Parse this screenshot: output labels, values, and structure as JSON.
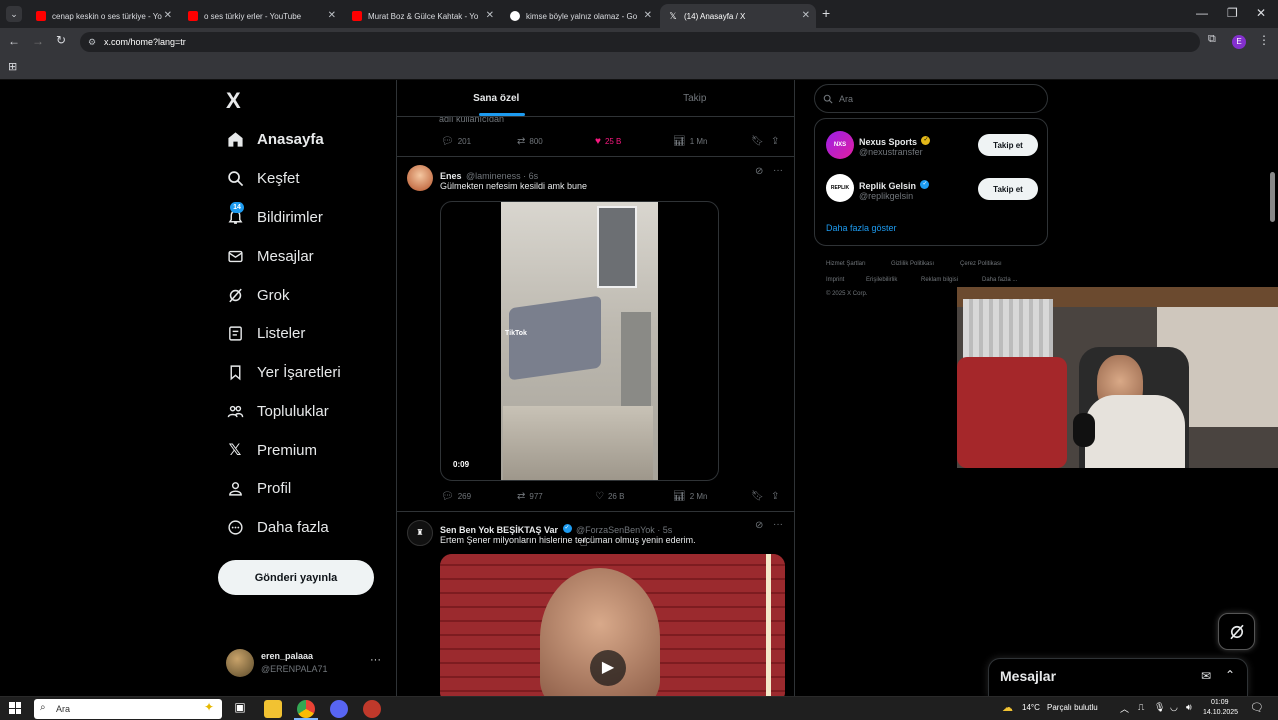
{
  "browser": {
    "tabs": [
      {
        "title": "cenap keskin o ses türkiye - Yo",
        "favicon_color": "#ff0000"
      },
      {
        "title": "o ses türkiy erler - YouTube",
        "favicon_color": "#ff0000"
      },
      {
        "title": "Murat Boz & Gülce Kahtak - Yo",
        "favicon_color": "#ff0000"
      },
      {
        "title": "kimse böyle yalnız olamaz - Go",
        "favicon_color": "#ffffff"
      },
      {
        "title": "(14) Anasayfa / X",
        "favicon_color": "#000000"
      }
    ],
    "new_tab": "+",
    "url": "x.com/home?lang=tr",
    "profile_initial": "E"
  },
  "nav": {
    "logo": "X",
    "items": [
      {
        "label": "Anasayfa",
        "icon": "home-icon"
      },
      {
        "label": "Keşfet",
        "icon": "search-icon"
      },
      {
        "label": "Bildirimler",
        "icon": "bell-icon",
        "badge": "14"
      },
      {
        "label": "Mesajlar",
        "icon": "mail-icon"
      },
      {
        "label": "Grok",
        "icon": "grok-icon"
      },
      {
        "label": "Listeler",
        "icon": "list-icon"
      },
      {
        "label": "Yer İşaretleri",
        "icon": "bookmark-icon"
      },
      {
        "label": "Topluluklar",
        "icon": "communities-icon"
      },
      {
        "label": "Premium",
        "icon": "x-premium-icon"
      },
      {
        "label": "Profil",
        "icon": "profile-icon"
      },
      {
        "label": "Daha fazla",
        "icon": "more-circle-icon"
      }
    ],
    "post_button": "Gönderi yayınla",
    "account": {
      "name": "eren_palaaa",
      "handle": "@ERENPALA71"
    }
  },
  "timeline": {
    "tabs": [
      {
        "label": "Sana özel"
      },
      {
        "label": "Takip"
      }
    ],
    "partial_tweet": {
      "text": "adlı kullanıcıdan",
      "replies": "201",
      "reposts": "800",
      "likes": "25 B",
      "views": "1 Mn"
    },
    "tweets": [
      {
        "name": "Enes",
        "handle": "@lamineness · 6s",
        "text": "Gülmekten nefesim kesildi amk bune",
        "video_time": "0:09",
        "watermark": "TikTok",
        "replies": "269",
        "reposts": "977",
        "likes": "26 B",
        "views": "2 Mn"
      },
      {
        "name": "Sen Ben Yok BEŞİKTAŞ Var",
        "handle": "@ForzaSenBenYok · 5s",
        "text": "Ertem Şener milyonların hislerine tercüman olmuş yenin ederim."
      }
    ]
  },
  "sidebar": {
    "search_placeholder": "Ara",
    "suggestions": [
      {
        "name": "Nexus Sports",
        "handle": "@nexustransfer",
        "verified_color": "#e2b719",
        "button": "Takip et"
      },
      {
        "name": "Replik Gelsin",
        "handle": "@replikgelsin",
        "verified_color": "#1d9bf0",
        "button": "Takip et"
      }
    ],
    "show_more": "Daha fazla göster",
    "footer": [
      "Hizmet Şartları",
      "Gizlilik Politikası",
      "Çerez Politikası",
      "Imprint",
      "Erişilebilirlik",
      "Reklam bilgisi",
      "Daha fazla ...",
      "© 2025 X Corp."
    ]
  },
  "messages_drawer": {
    "title": "Mesajlar"
  },
  "taskbar": {
    "search": "Ara",
    "weather_temp": "14°C",
    "weather_text": "Parçalı bulutlu",
    "time": "01:09",
    "date": "14.10.2025"
  },
  "colors": {
    "accent": "#1d9bf0",
    "like": "#f91880",
    "background": "#000000"
  }
}
